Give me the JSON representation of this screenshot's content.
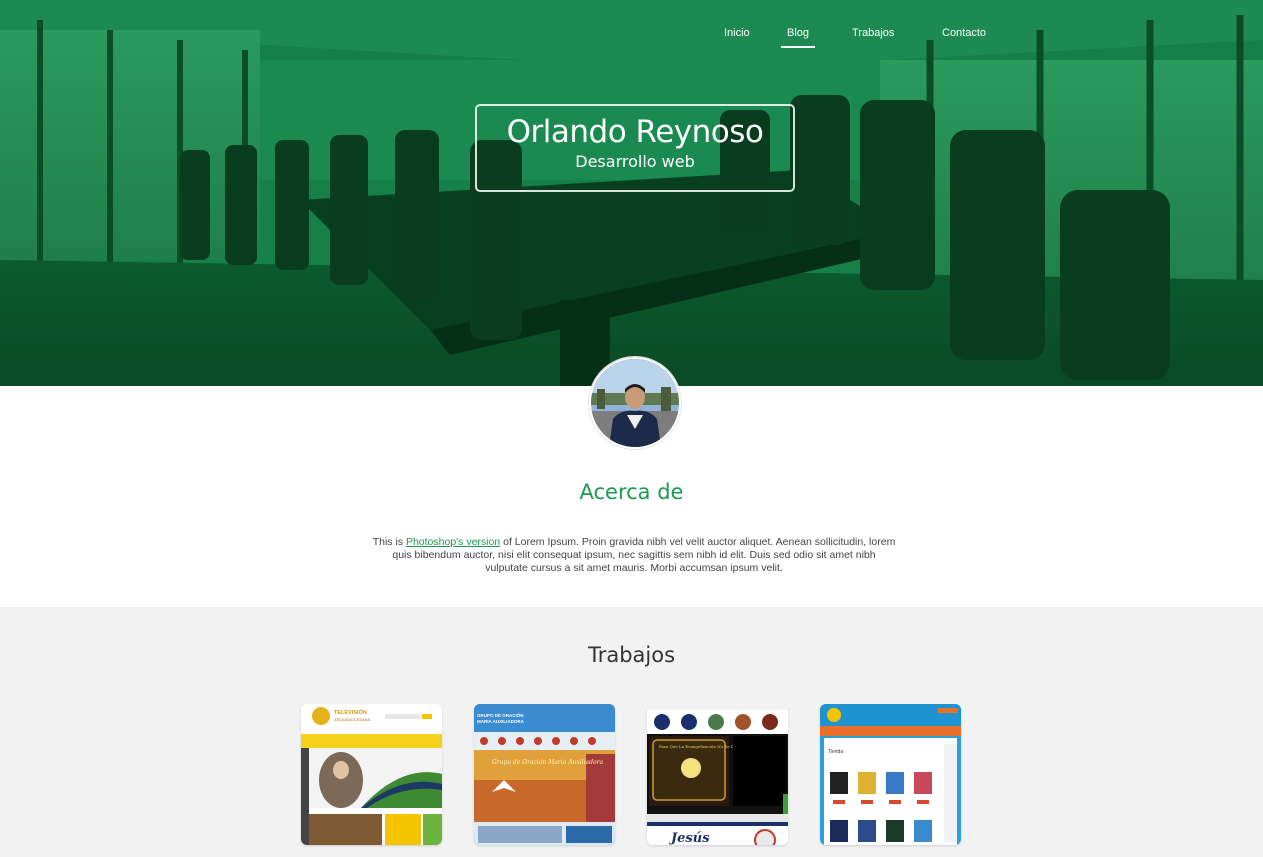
{
  "nav": {
    "items": [
      {
        "label": "Inicio",
        "active": false
      },
      {
        "label": "Blog",
        "active": true
      },
      {
        "label": "Trabajos",
        "active": false
      },
      {
        "label": "Contacto",
        "active": false
      }
    ]
  },
  "hero": {
    "name": "Orlando Reynoso",
    "subtitle": "Desarrollo web",
    "overlay_color": "#0f6b38"
  },
  "about": {
    "heading": "Acerca de",
    "text_before": "This is ",
    "link_text": "Photoshop's version",
    "text_after": "  of Lorem Ipsum. Proin gravida nibh vel velit auctor aliquet. Aenean sollicitudin, lorem quis bibendum auctor, nisi elit consequat ipsum, nec sagittis sem nibh id elit. Duis sed odio sit amet nibh vulputate cursus a sit amet mauris. Morbi accumsan ipsum velit.",
    "accent_color": "#1b9a52"
  },
  "works": {
    "heading": "Trabajos",
    "thumb1": {
      "brand_line1": "TELEVISIÓN",
      "brand_line2": "ARQUIDIOCESANA"
    },
    "thumb2": {
      "header_line1": "GRUPO DE ORACIÓN",
      "header_line2": "MARIA AUXILIADORA",
      "banner_text": "Grupo de Oración Maria Auxiliadora"
    },
    "thumb3": {
      "promo_text": "Para Que La Evangelización No Se Detenga",
      "footer_text": "Jesús"
    },
    "thumb4": {
      "section_label": "Tienda"
    }
  }
}
